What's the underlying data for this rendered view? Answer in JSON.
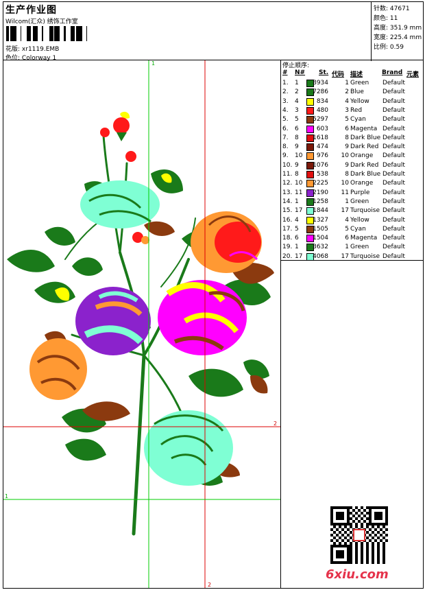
{
  "header": {
    "title": "生产作业图",
    "company": "Wilcom(汇众) 绣饰工作室",
    "design_label": "花版:",
    "design_value": "xr1119.EMB",
    "colorway_label": "色位:",
    "colorway_value": "Colorway 1"
  },
  "stats": [
    {
      "label": "针数:",
      "value": "47671"
    },
    {
      "label": "颜色:",
      "value": "11"
    },
    {
      "label": "高度:",
      "value": "351.9 mm"
    },
    {
      "label": "宽度:",
      "value": "225.4 mm"
    },
    {
      "label": "比例:",
      "value": "0.59"
    }
  ],
  "sequence": {
    "title": "停止顺序:",
    "headers": {
      "num": "#",
      "needle": "N#",
      "st": "St.",
      "code": "代码",
      "desc": "描述",
      "brand": "Brand",
      "element": "元素"
    },
    "rows": [
      {
        "num": "1.",
        "needle": "1",
        "color": "#1a7a1a",
        "st": "8934",
        "code": "1",
        "desc": "Green",
        "brand": "Default"
      },
      {
        "num": "2.",
        "needle": "2",
        "color": "#1a7a1a",
        "st": "7286",
        "code": "2",
        "desc": "Blue",
        "brand": "Default"
      },
      {
        "num": "3.",
        "needle": "4",
        "color": "#ffff00",
        "st": "834",
        "code": "4",
        "desc": "Yellow",
        "brand": "Default"
      },
      {
        "num": "4.",
        "needle": "3",
        "color": "#ff1a1a",
        "st": "480",
        "code": "3",
        "desc": "Red",
        "brand": "Default"
      },
      {
        "num": "5.",
        "needle": "5",
        "color": "#8b3a0f",
        "st": "5297",
        "code": "5",
        "desc": "Cyan",
        "brand": "Default"
      },
      {
        "num": "6.",
        "needle": "6",
        "color": "#ff00ff",
        "st": "603",
        "code": "6",
        "desc": "Magenta",
        "brand": "Default"
      },
      {
        "num": "7.",
        "needle": "8",
        "color": "#e01010",
        "st": "1618",
        "code": "8",
        "desc": "Dark Blue",
        "brand": "Default"
      },
      {
        "num": "8.",
        "needle": "9",
        "color": "#7a1a0a",
        "st": "474",
        "code": "9",
        "desc": "Dark Red",
        "brand": "Default"
      },
      {
        "num": "9.",
        "needle": "10",
        "color": "#ff9933",
        "st": "976",
        "code": "10",
        "desc": "Orange",
        "brand": "Default"
      },
      {
        "num": "10.",
        "needle": "9",
        "color": "#7a1a0a",
        "st": "1076",
        "code": "9",
        "desc": "Dark Red",
        "brand": "Default"
      },
      {
        "num": "11.",
        "needle": "8",
        "color": "#e01010",
        "st": "538",
        "code": "8",
        "desc": "Dark Blue",
        "brand": "Default"
      },
      {
        "num": "12.",
        "needle": "10",
        "color": "#ff9933",
        "st": "2225",
        "code": "10",
        "desc": "Orange",
        "brand": "Default"
      },
      {
        "num": "13.",
        "needle": "11",
        "color": "#8b22cc",
        "st": "2190",
        "code": "11",
        "desc": "Purple",
        "brand": "Default"
      },
      {
        "num": "14.",
        "needle": "1",
        "color": "#1a7a1a",
        "st": "1258",
        "code": "1",
        "desc": "Green",
        "brand": "Default"
      },
      {
        "num": "15.",
        "needle": "17",
        "color": "#7fffd4",
        "st": "1844",
        "code": "17",
        "desc": "Turquoise",
        "brand": "Default"
      },
      {
        "num": "16.",
        "needle": "4",
        "color": "#ffff00",
        "st": "1327",
        "code": "4",
        "desc": "Yellow",
        "brand": "Default"
      },
      {
        "num": "17.",
        "needle": "5",
        "color": "#8b3a0f",
        "st": "1505",
        "code": "5",
        "desc": "Cyan",
        "brand": "Default"
      },
      {
        "num": "18.",
        "needle": "6",
        "color": "#ff00ff",
        "st": "1504",
        "code": "6",
        "desc": "Magenta",
        "brand": "Default"
      },
      {
        "num": "19.",
        "needle": "1",
        "color": "#1a7a1a",
        "st": "3632",
        "code": "1",
        "desc": "Green",
        "brand": "Default"
      },
      {
        "num": "20.",
        "needle": "17",
        "color": "#7fffd4",
        "st": "4068",
        "code": "17",
        "desc": "Turquoise",
        "brand": "Default"
      }
    ]
  },
  "guides": {
    "v1": "1",
    "v2": "2",
    "h1": "1",
    "h2": "2"
  },
  "watermark": "6xiu.com",
  "colors": {
    "green": "#1a7a1a",
    "turquoise": "#7fffd4",
    "red": "#ff1a1a",
    "orange": "#ff9933",
    "magenta": "#ff00ff",
    "yellow": "#ffff00",
    "purple": "#8b22cc",
    "brown": "#8b3a0f",
    "guide_green": "#00cc00",
    "guide_red": "#dd0000"
  }
}
